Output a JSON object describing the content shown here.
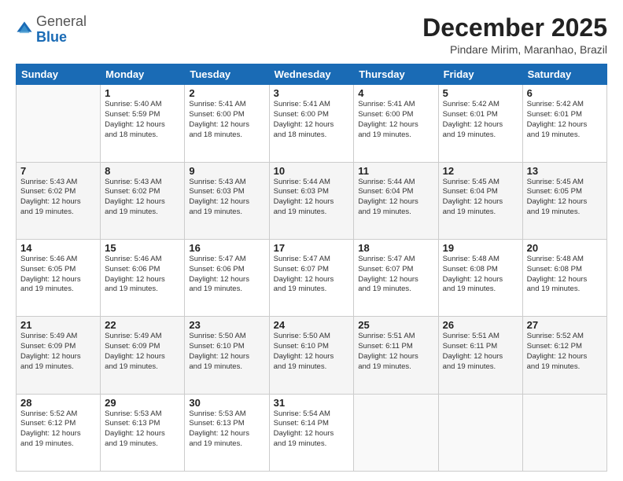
{
  "header": {
    "logo_general": "General",
    "logo_blue": "Blue",
    "title": "December 2025",
    "subtitle": "Pindare Mirim, Maranhao, Brazil"
  },
  "days_of_week": [
    "Sunday",
    "Monday",
    "Tuesday",
    "Wednesday",
    "Thursday",
    "Friday",
    "Saturday"
  ],
  "weeks": [
    [
      {
        "day": "",
        "info": ""
      },
      {
        "day": "1",
        "info": "Sunrise: 5:40 AM\nSunset: 5:59 PM\nDaylight: 12 hours\nand 18 minutes."
      },
      {
        "day": "2",
        "info": "Sunrise: 5:41 AM\nSunset: 6:00 PM\nDaylight: 12 hours\nand 18 minutes."
      },
      {
        "day": "3",
        "info": "Sunrise: 5:41 AM\nSunset: 6:00 PM\nDaylight: 12 hours\nand 18 minutes."
      },
      {
        "day": "4",
        "info": "Sunrise: 5:41 AM\nSunset: 6:00 PM\nDaylight: 12 hours\nand 19 minutes."
      },
      {
        "day": "5",
        "info": "Sunrise: 5:42 AM\nSunset: 6:01 PM\nDaylight: 12 hours\nand 19 minutes."
      },
      {
        "day": "6",
        "info": "Sunrise: 5:42 AM\nSunset: 6:01 PM\nDaylight: 12 hours\nand 19 minutes."
      }
    ],
    [
      {
        "day": "7",
        "info": "Sunrise: 5:43 AM\nSunset: 6:02 PM\nDaylight: 12 hours\nand 19 minutes."
      },
      {
        "day": "8",
        "info": "Sunrise: 5:43 AM\nSunset: 6:02 PM\nDaylight: 12 hours\nand 19 minutes."
      },
      {
        "day": "9",
        "info": "Sunrise: 5:43 AM\nSunset: 6:03 PM\nDaylight: 12 hours\nand 19 minutes."
      },
      {
        "day": "10",
        "info": "Sunrise: 5:44 AM\nSunset: 6:03 PM\nDaylight: 12 hours\nand 19 minutes."
      },
      {
        "day": "11",
        "info": "Sunrise: 5:44 AM\nSunset: 6:04 PM\nDaylight: 12 hours\nand 19 minutes."
      },
      {
        "day": "12",
        "info": "Sunrise: 5:45 AM\nSunset: 6:04 PM\nDaylight: 12 hours\nand 19 minutes."
      },
      {
        "day": "13",
        "info": "Sunrise: 5:45 AM\nSunset: 6:05 PM\nDaylight: 12 hours\nand 19 minutes."
      }
    ],
    [
      {
        "day": "14",
        "info": "Sunrise: 5:46 AM\nSunset: 6:05 PM\nDaylight: 12 hours\nand 19 minutes."
      },
      {
        "day": "15",
        "info": "Sunrise: 5:46 AM\nSunset: 6:06 PM\nDaylight: 12 hours\nand 19 minutes."
      },
      {
        "day": "16",
        "info": "Sunrise: 5:47 AM\nSunset: 6:06 PM\nDaylight: 12 hours\nand 19 minutes."
      },
      {
        "day": "17",
        "info": "Sunrise: 5:47 AM\nSunset: 6:07 PM\nDaylight: 12 hours\nand 19 minutes."
      },
      {
        "day": "18",
        "info": "Sunrise: 5:47 AM\nSunset: 6:07 PM\nDaylight: 12 hours\nand 19 minutes."
      },
      {
        "day": "19",
        "info": "Sunrise: 5:48 AM\nSunset: 6:08 PM\nDaylight: 12 hours\nand 19 minutes."
      },
      {
        "day": "20",
        "info": "Sunrise: 5:48 AM\nSunset: 6:08 PM\nDaylight: 12 hours\nand 19 minutes."
      }
    ],
    [
      {
        "day": "21",
        "info": "Sunrise: 5:49 AM\nSunset: 6:09 PM\nDaylight: 12 hours\nand 19 minutes."
      },
      {
        "day": "22",
        "info": "Sunrise: 5:49 AM\nSunset: 6:09 PM\nDaylight: 12 hours\nand 19 minutes."
      },
      {
        "day": "23",
        "info": "Sunrise: 5:50 AM\nSunset: 6:10 PM\nDaylight: 12 hours\nand 19 minutes."
      },
      {
        "day": "24",
        "info": "Sunrise: 5:50 AM\nSunset: 6:10 PM\nDaylight: 12 hours\nand 19 minutes."
      },
      {
        "day": "25",
        "info": "Sunrise: 5:51 AM\nSunset: 6:11 PM\nDaylight: 12 hours\nand 19 minutes."
      },
      {
        "day": "26",
        "info": "Sunrise: 5:51 AM\nSunset: 6:11 PM\nDaylight: 12 hours\nand 19 minutes."
      },
      {
        "day": "27",
        "info": "Sunrise: 5:52 AM\nSunset: 6:12 PM\nDaylight: 12 hours\nand 19 minutes."
      }
    ],
    [
      {
        "day": "28",
        "info": "Sunrise: 5:52 AM\nSunset: 6:12 PM\nDaylight: 12 hours\nand 19 minutes."
      },
      {
        "day": "29",
        "info": "Sunrise: 5:53 AM\nSunset: 6:13 PM\nDaylight: 12 hours\nand 19 minutes."
      },
      {
        "day": "30",
        "info": "Sunrise: 5:53 AM\nSunset: 6:13 PM\nDaylight: 12 hours\nand 19 minutes."
      },
      {
        "day": "31",
        "info": "Sunrise: 5:54 AM\nSunset: 6:14 PM\nDaylight: 12 hours\nand 19 minutes."
      },
      {
        "day": "",
        "info": ""
      },
      {
        "day": "",
        "info": ""
      },
      {
        "day": "",
        "info": ""
      }
    ]
  ]
}
